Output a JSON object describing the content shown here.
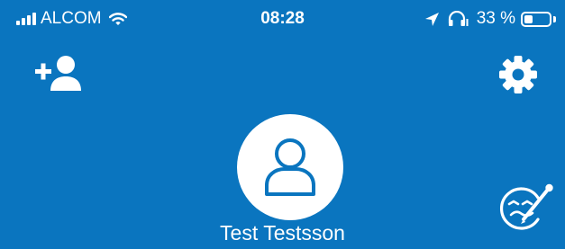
{
  "status_bar": {
    "carrier": "ALCOM",
    "time": "08:28",
    "battery_percent": "33 %",
    "battery_level": 0.33,
    "icons": [
      "signal-icon",
      "wifi-icon",
      "location-arrow-icon",
      "headphones-icon",
      "battery-icon"
    ]
  },
  "header": {
    "add_user_icon": "add-user-icon",
    "settings_icon": "gear-icon"
  },
  "profile": {
    "avatar_icon": "user-icon",
    "name": "Test Testsson",
    "feedback_icon": "feedback-face-pen-icon"
  },
  "colors": {
    "background": "#0a75bf",
    "foreground": "#ffffff",
    "avatar_icon": "#0a75bf"
  }
}
